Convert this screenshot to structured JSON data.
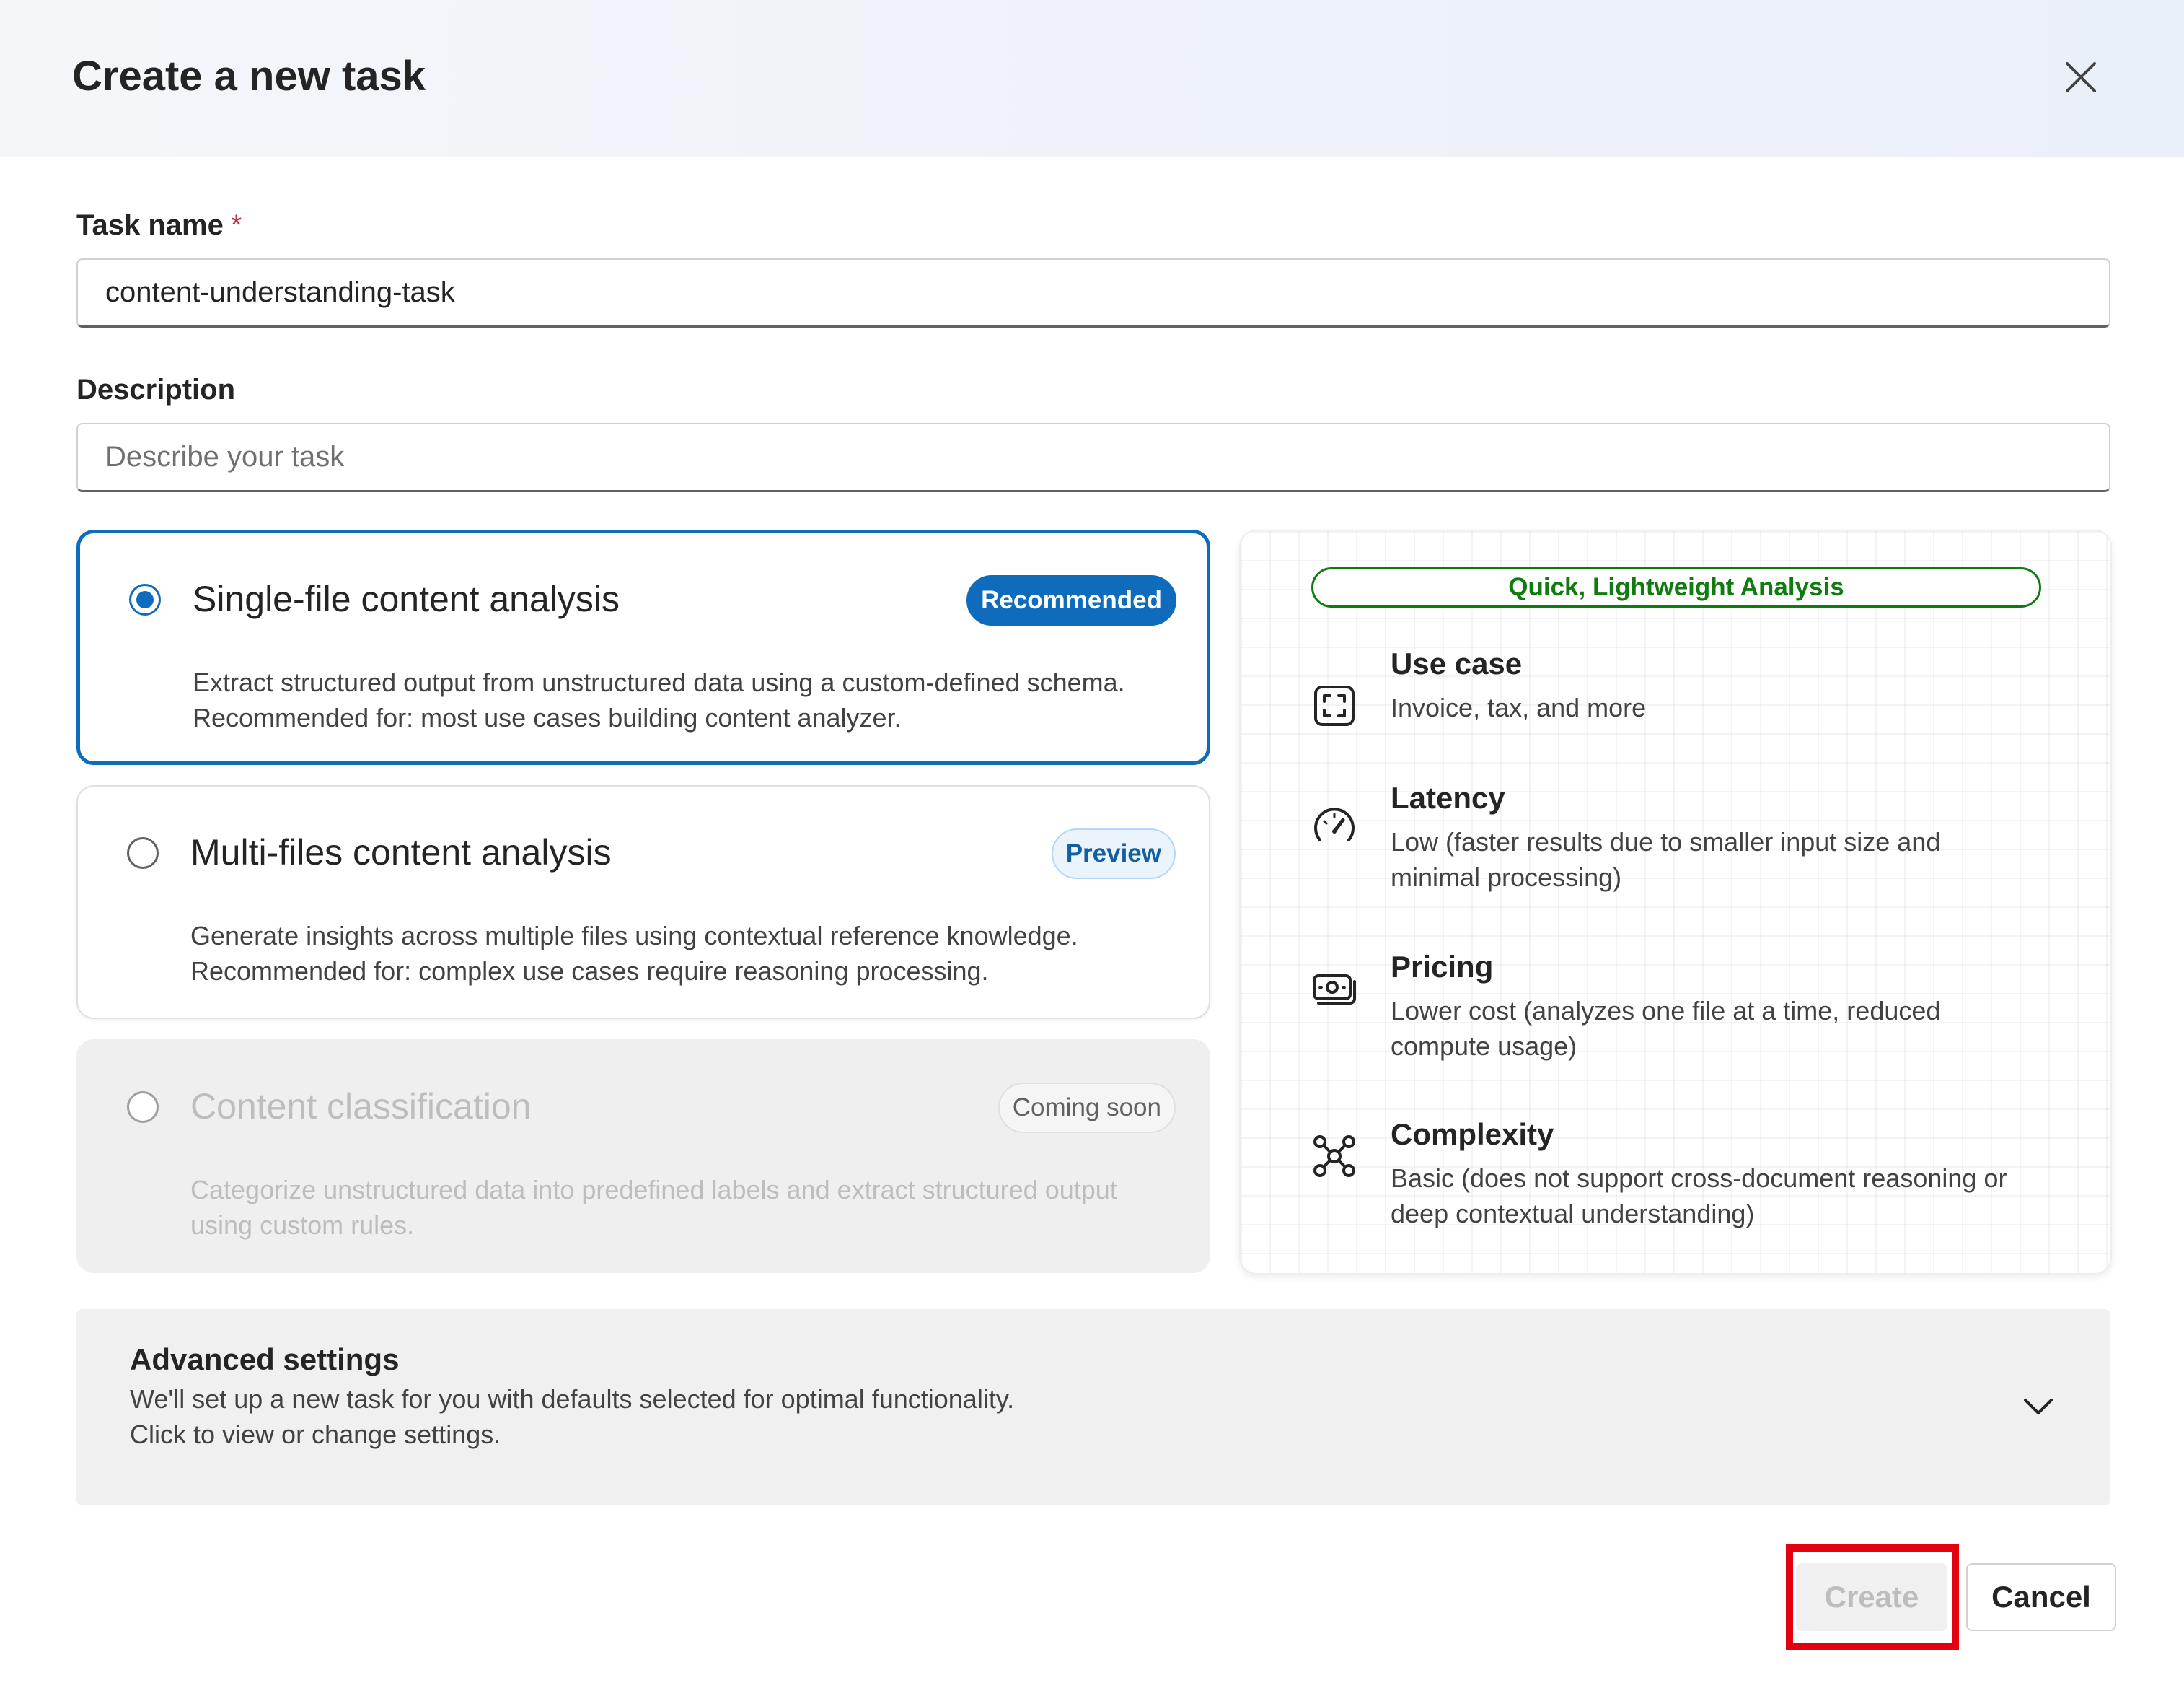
{
  "dialog": {
    "title": "Create a new task",
    "close_icon": "close-icon"
  },
  "form": {
    "task_name": {
      "label": "Task name",
      "required_mark": "*",
      "value": "content-understanding-task"
    },
    "description": {
      "label": "Description",
      "placeholder": "Describe your task",
      "value": ""
    }
  },
  "options": [
    {
      "title": "Single-file content analysis",
      "badge": "Recommended",
      "description_lines": [
        "Extract structured output from unstructured data using a custom-defined schema.",
        "Recommended for: most use cases building content analyzer."
      ],
      "selected": true,
      "disabled": false
    },
    {
      "title": "Multi-files content analysis",
      "badge": "Preview",
      "description_lines": [
        "Generate insights across multiple files using contextual reference knowledge.",
        "Recommended for: complex use cases require reasoning processing."
      ],
      "selected": false,
      "disabled": false
    },
    {
      "title": "Content classification",
      "badge": "Coming soon",
      "description_lines": [
        "Categorize unstructured data into predefined labels and extract structured output",
        "using custom rules."
      ],
      "selected": false,
      "disabled": true
    }
  ],
  "info_panel": {
    "pill": "Quick, Lightweight Analysis",
    "items": [
      {
        "icon": "scan-frame-icon",
        "title": "Use case",
        "lines": [
          "Invoice, tax, and more"
        ]
      },
      {
        "icon": "speedometer-icon",
        "title": "Latency",
        "lines": [
          "Low (faster results due to smaller input size and",
          "minimal processing)"
        ]
      },
      {
        "icon": "money-icon",
        "title": "Pricing",
        "lines": [
          "Lower cost (analyzes one file at a time, reduced",
          "compute usage)"
        ]
      },
      {
        "icon": "network-nodes-icon",
        "title": "Complexity",
        "lines": [
          "Basic (does not support cross-document reasoning or",
          "deep contextual understanding)"
        ]
      }
    ]
  },
  "advanced_settings": {
    "title": "Advanced settings",
    "lines": [
      "We'll set up a new task for you with defaults selected for optimal functionality.",
      "Click to view or change settings."
    ],
    "icon": "chevron-down-icon"
  },
  "footer": {
    "create_label": "Create",
    "cancel_label": "Cancel",
    "highlight_color": "#e3000f"
  },
  "colors": {
    "accent": "#0f6cbd",
    "success": "#107c10"
  }
}
